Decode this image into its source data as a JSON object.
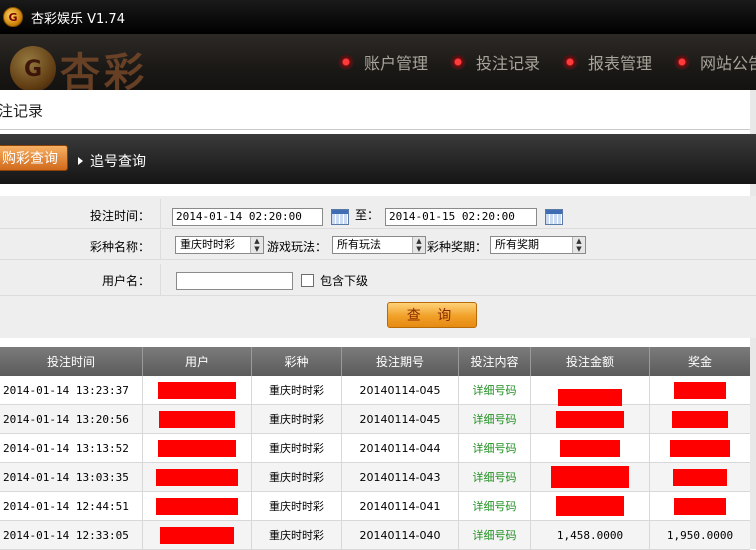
{
  "window": {
    "title": "杏彩娱乐 V1.74",
    "icon_letter": "G"
  },
  "banner": {
    "logo_letter": "G",
    "logo_text": "杏彩",
    "nav": [
      {
        "label": "账户管理"
      },
      {
        "label": "投注记录"
      },
      {
        "label": "报表管理"
      },
      {
        "label": "网站公告"
      }
    ]
  },
  "page": {
    "title": "注记录"
  },
  "tabs": {
    "active": "购彩查询",
    "other": "追号查询"
  },
  "form": {
    "time_label": "投注时间：",
    "time_from": "2014-01-14 02:20:00",
    "to_label": "至：",
    "time_to": "2014-01-15 02:20:00",
    "lottery_label": "彩种名称：",
    "lottery_value": "重庆时时彩",
    "play_label": "游戏玩法：",
    "play_value": "所有玩法",
    "period_label": "彩种奖期：",
    "period_value": "所有奖期",
    "user_label": "用户名：",
    "user_value": "",
    "include_sub_label": "包含下级",
    "query_button": "查 询"
  },
  "table": {
    "headers": [
      "投注时间",
      "用户",
      "彩种",
      "投注期号",
      "投注内容",
      "投注金额",
      "奖金"
    ],
    "rows": [
      {
        "time": "2014-01-14 13:23:37",
        "lottery": "重庆时时彩",
        "issue": "20140114-045",
        "content": "详细号码",
        "amount": "",
        "bonus": ""
      },
      {
        "time": "2014-01-14 13:20:56",
        "lottery": "重庆时时彩",
        "issue": "20140114-045",
        "content": "详细号码",
        "amount": "",
        "bonus": ""
      },
      {
        "time": "2014-01-14 13:13:52",
        "lottery": "重庆时时彩",
        "issue": "20140114-044",
        "content": "详细号码",
        "amount": "",
        "bonus": ""
      },
      {
        "time": "2014-01-14 13:03:35",
        "lottery": "重庆时时彩",
        "issue": "20140114-043",
        "content": "详细号码",
        "amount": "",
        "bonus": ""
      },
      {
        "time": "2014-01-14 12:44:51",
        "lottery": "重庆时时彩",
        "issue": "20140114-041",
        "content": "详细号码",
        "amount": "",
        "bonus": ""
      },
      {
        "time": "2014-01-14 12:33:05",
        "lottery": "重庆时时彩",
        "issue": "20140114-040",
        "content": "详细号码",
        "amount": "1,458.0000",
        "bonus": "1,950.0000"
      }
    ]
  },
  "colors": {
    "accent": "#f0a028",
    "detail_link": "#1f8f1f",
    "redaction": "#ff0000"
  }
}
